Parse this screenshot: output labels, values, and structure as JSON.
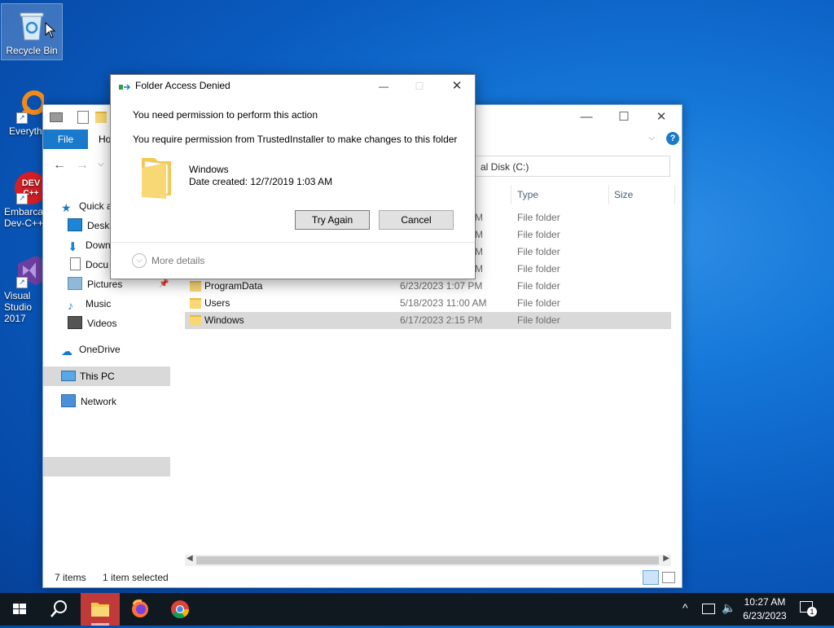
{
  "desktop": {
    "icons": [
      {
        "label": "Recycle Bin"
      },
      {
        "label": "Everything"
      },
      {
        "label": "Embarcadero Dev-C++"
      },
      {
        "label": "Visual Studio 2017"
      }
    ]
  },
  "explorer": {
    "ribbon": {
      "file_tab": "File",
      "home_tab": "Ho"
    },
    "address": "al Disk (C:)",
    "columns": {
      "type": "Type",
      "size": "Size"
    },
    "nav": {
      "quick_access": "Quick a",
      "desktop": "Deskt",
      "downloads": "Down",
      "documents": "Docu",
      "pictures": "Pictures",
      "music": "Music",
      "videos": "Videos",
      "onedrive": "OneDrive",
      "this_pc": "This PC",
      "network": "Network"
    },
    "rows": [
      {
        "name": "",
        "date": "M",
        "type": "File folder"
      },
      {
        "name": "",
        "date": "M",
        "type": "File folder"
      },
      {
        "name": "",
        "date": "M",
        "type": "File folder"
      },
      {
        "name": "",
        "date": "M",
        "type": "File folder"
      },
      {
        "name": "ProgramData",
        "date": "6/23/2023 1:07 PM",
        "type": "File folder"
      },
      {
        "name": "Users",
        "date": "5/18/2023 11:00 AM",
        "type": "File folder"
      },
      {
        "name": "Windows",
        "date": "6/17/2023 2:15 PM",
        "type": "File folder"
      }
    ],
    "status": {
      "items": "7 items",
      "selected": "1 item selected"
    }
  },
  "dialog": {
    "title": "Folder Access Denied",
    "heading": "You need permission to perform this action",
    "message": "You require permission from TrustedInstaller to make changes to this folder",
    "folder_name": "Windows",
    "folder_date": "Date created: 12/7/2019 1:03 AM",
    "try_again": "Try Again",
    "cancel": "Cancel",
    "more_details": "More details"
  },
  "taskbar": {
    "time": "10:27 AM",
    "date": "6/23/2023",
    "notification_count": "1"
  },
  "colors": {
    "accent": "#1979ca",
    "taskbar": "#101820",
    "selection": "#d9d9d9"
  }
}
